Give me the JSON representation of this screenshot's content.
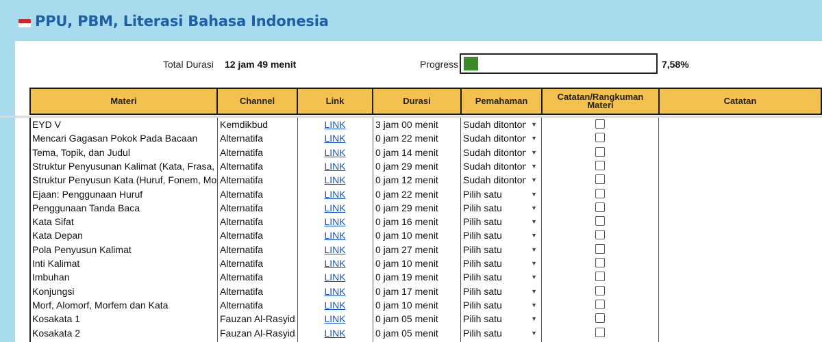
{
  "title": "PPU, PBM, Literasi Bahasa Indonesia",
  "flag_icon": "indonesia-flag-icon",
  "summary": {
    "total_label": "Total Durasi",
    "total_value": "12 jam 49 menit",
    "progress_label": "Progress",
    "progress_value": "7,58%",
    "progress_fraction": 0.0758,
    "progress_color": "#3a8a2a"
  },
  "columns": {
    "materi": "Materi",
    "channel": "Channel",
    "link": "Link",
    "durasi": "Durasi",
    "pemahaman": "Pemahaman",
    "catatan_rangkuman": "Catatan/Rangkuman Materi",
    "catatan": "Catatan"
  },
  "header_color": "#f2c14e",
  "rows": [
    {
      "materi": "EYD V",
      "channel": "Kemdikbud",
      "link": "LINK",
      "durasi": "3 jam 00 menit",
      "pemahaman": "Sudah ditonton"
    },
    {
      "materi": "Mencari Gagasan Pokok Pada Bacaan",
      "channel": "Alternatifa",
      "link": "LINK",
      "durasi": "0 jam 22 menit",
      "pemahaman": "Sudah ditonton"
    },
    {
      "materi": "Tema, Topik, dan Judul",
      "channel": "Alternatifa",
      "link": "LINK",
      "durasi": "0 jam 14 menit",
      "pemahaman": "Sudah ditonton"
    },
    {
      "materi": "Struktur Penyusunan Kalimat (Kata, Frasa,",
      "channel": "Alternatifa",
      "link": "LINK",
      "durasi": "0 jam 29 menit",
      "pemahaman": "Sudah ditonton"
    },
    {
      "materi": "Struktur Penyusun Kata (Huruf, Fonem, Mo",
      "channel": "Alternatifa",
      "link": "LINK",
      "durasi": "0 jam 12 menit",
      "pemahaman": "Sudah ditonton"
    },
    {
      "materi": "Ejaan: Penggunaan Huruf",
      "channel": "Alternatifa",
      "link": "LINK",
      "durasi": "0 jam 22 menit",
      "pemahaman": "Pilih satu"
    },
    {
      "materi": "Penggunaan Tanda Baca",
      "channel": "Alternatifa",
      "link": "LINK",
      "durasi": "0 jam 29 menit",
      "pemahaman": "Pilih satu"
    },
    {
      "materi": "Kata Sifat",
      "channel": "Alternatifa",
      "link": "LINK",
      "durasi": "0 jam 16 menit",
      "pemahaman": "Pilih satu"
    },
    {
      "materi": "Kata Depan",
      "channel": "Alternatifa",
      "link": "LINK",
      "durasi": "0 jam 10 menit",
      "pemahaman": "Pilih satu"
    },
    {
      "materi": "Pola Penyusun Kalimat",
      "channel": "Alternatifa",
      "link": "LINK",
      "durasi": "0 jam 27 menit",
      "pemahaman": "Pilih satu"
    },
    {
      "materi": "Inti Kalimat",
      "channel": "Alternatifa",
      "link": "LINK",
      "durasi": "0 jam 10 menit",
      "pemahaman": "Pilih satu"
    },
    {
      "materi": "Imbuhan",
      "channel": "Alternatifa",
      "link": "LINK",
      "durasi": "0 jam 19 menit",
      "pemahaman": "Pilih satu"
    },
    {
      "materi": "Konjungsi",
      "channel": "Alternatifa",
      "link": "LINK",
      "durasi": "0 jam 17 menit",
      "pemahaman": "Pilih satu"
    },
    {
      "materi": "Morf, Alomorf, Morfem dan Kata",
      "channel": "Alternatifa",
      "link": "LINK",
      "durasi": "0 jam 10 menit",
      "pemahaman": "Pilih satu"
    },
    {
      "materi": "Kosakata 1",
      "channel": "Fauzan Al-Rasyid",
      "link": "LINK",
      "durasi": "0 jam 05 menit",
      "pemahaman": "Pilih satu"
    },
    {
      "materi": "Kosakata 2",
      "channel": "Fauzan Al-Rasyid",
      "link": "LINK",
      "durasi": "0 jam 05 menit",
      "pemahaman": "Pilih satu"
    }
  ]
}
